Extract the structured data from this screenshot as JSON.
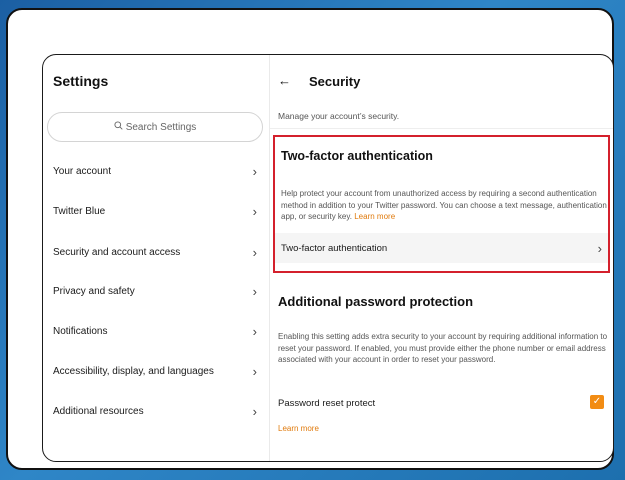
{
  "settings": {
    "title": "Settings",
    "search_placeholder": "Search Settings",
    "search_icon": "search-icon",
    "nav": [
      {
        "label": "Your account"
      },
      {
        "label": "Twitter Blue"
      },
      {
        "label": "Security and account access"
      },
      {
        "label": "Privacy and safety"
      },
      {
        "label": "Notifications"
      },
      {
        "label": "Accessibility, display, and languages"
      },
      {
        "label": "Additional resources"
      }
    ]
  },
  "security": {
    "title": "Security",
    "subtitle": "Manage your account’s security.",
    "two_factor": {
      "heading": "Two-factor authentication",
      "description": "Help protect your account from unauthorized access by requiring a second authentication method in addition to your Twitter password. You can choose a text message, authentication app, or security key.",
      "learn_more": "Learn more",
      "row_label": "Two-factor authentication"
    },
    "additional": {
      "heading": "Additional password protection",
      "description": "Enabling this setting adds extra security to your account by requiring additional information to reset your password. If enabled, you must provide either the phone number or email address associated with your account in order to reset your password.",
      "option_label": "Password reset protect",
      "option_checked": true,
      "learn_more": "Learn more"
    }
  },
  "colors": {
    "accent": "#f28c13",
    "highlight_border": "#d4202c",
    "background_blue": "#2f86c7"
  }
}
